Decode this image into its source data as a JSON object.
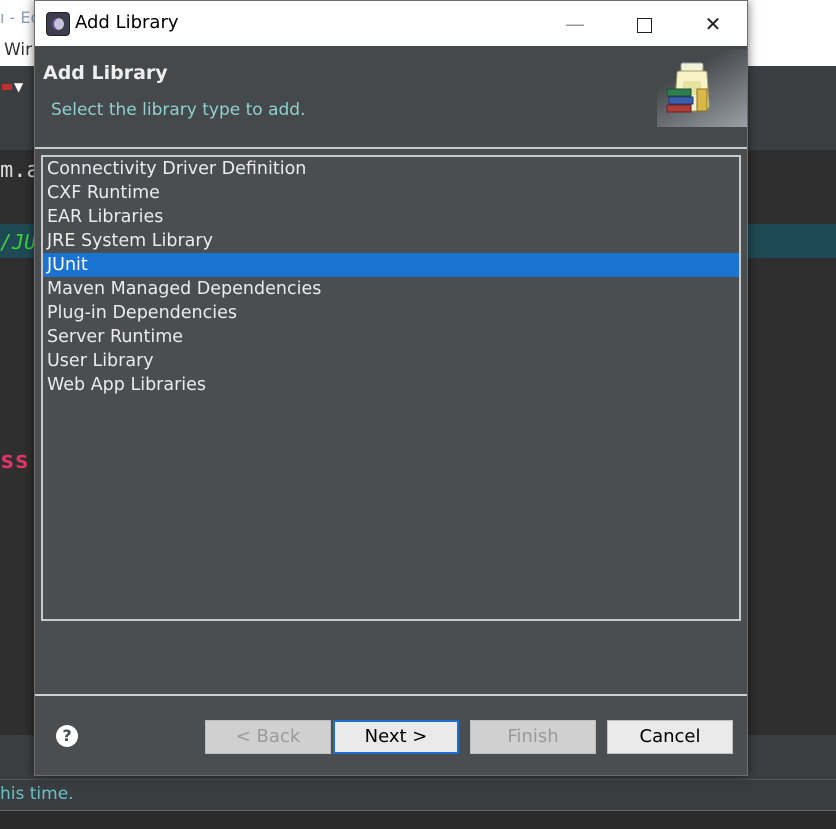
{
  "background": {
    "title_fragment": "ı - Ec",
    "menu_fragment": "Wir",
    "code_line_1": "m.a",
    "code_line_2": "/JU",
    "code_line_3": "ss",
    "status_text": "his time."
  },
  "dialog": {
    "window_title": "Add Library",
    "header_title": "Add Library",
    "header_description": "Select the library type to add.",
    "libraries": [
      {
        "label": "Connectivity Driver Definition",
        "selected": false
      },
      {
        "label": "CXF Runtime",
        "selected": false
      },
      {
        "label": "EAR Libraries",
        "selected": false
      },
      {
        "label": "JRE System Library",
        "selected": false
      },
      {
        "label": "JUnit",
        "selected": true
      },
      {
        "label": "Maven Managed Dependencies",
        "selected": false
      },
      {
        "label": "Plug-in Dependencies",
        "selected": false
      },
      {
        "label": "Server Runtime",
        "selected": false
      },
      {
        "label": "User Library",
        "selected": false
      },
      {
        "label": "Web App Libraries",
        "selected": false
      }
    ],
    "buttons": {
      "help": "?",
      "back": "< Back",
      "next": "Next >",
      "finish": "Finish",
      "cancel": "Cancel"
    },
    "window_controls": {
      "minimize": "—",
      "close": "✕"
    }
  },
  "colors": {
    "selection": "#1a73d0",
    "dialog_bg": "#4a4e51",
    "description_text": "#8fd0d0"
  },
  "icons": {
    "app": "eclipse-icon",
    "wizard_banner": "library-jar-icon",
    "help": "help-icon"
  }
}
